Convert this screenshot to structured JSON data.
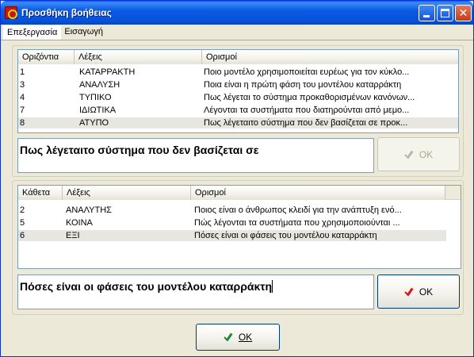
{
  "window": {
    "title": "Προσθήκη βοήθειας"
  },
  "menu": [
    {
      "label": "Επεξεργασία"
    },
    {
      "label": "Εισαγωγή"
    }
  ],
  "horizontal": {
    "columns": [
      "Οριζόντια",
      "Λέξεις",
      "Ορισμοί"
    ],
    "rows": [
      {
        "num": "1",
        "word": "ΚΑΤΑΡΡΑΚΤΗ",
        "definition": "Ποιο μοντέλο χρησιμοποιείται ευρέως για τον κύκλο..."
      },
      {
        "num": "3",
        "word": "ΑΝΑΛΥΣΗ",
        "definition": "Ποια είναι η πρώτη φάση του μοντέλου καταρράκτη"
      },
      {
        "num": "4",
        "word": "ΤΥΠΙΚΟ",
        "definition": "Πως λέγεται το σύστημα προκαθορισμένων κανόνων..."
      },
      {
        "num": "7",
        "word": "ΙΔΙΩΤΙΚΑ",
        "definition": "Λέγονται τα συστήματα που διατηρούνται από μεμο..."
      },
      {
        "num": "8",
        "word": "ΑΤΥΠΟ",
        "definition": "Πως λέγεταιτο σύστημα που δεν βασίζεται σε προκ..."
      }
    ],
    "edit_value": "Πως λέγεταιτο σύστημα που δεν βασίζεται σε",
    "ok_label": "OK"
  },
  "vertical": {
    "columns": [
      "Κάθετα",
      "Λέξεις",
      "Ορισμοί"
    ],
    "rows": [
      {
        "num": "2",
        "word": "ΑΝΑΛΥΤΗΣ",
        "definition": "Ποιος είναι ο άνθρωπος κλειδί για την ανάπτυξη ενό..."
      },
      {
        "num": "5",
        "word": "ΚΟΙΝΑ",
        "definition": "Πώς λέγονται τα συστήματα που χρησιμοποιούνται ..."
      },
      {
        "num": "6",
        "word": "ΕΞΙ",
        "definition": "Πόσες είναι οι φάσεις του μοντέλου καταρράκτη"
      }
    ],
    "edit_value": "Πόσες είναι οι φάσεις του μοντέλου καταρράκτη",
    "ok_label": "OK"
  },
  "footer": {
    "ok_label": "OK"
  },
  "icons": {
    "app": "app-icon",
    "check": "check-icon"
  },
  "colors": {
    "titlebar": "#0652d9",
    "selected_row": "#e7e6e0",
    "check_red": "#d41616",
    "check_green": "#1f8a2f"
  }
}
